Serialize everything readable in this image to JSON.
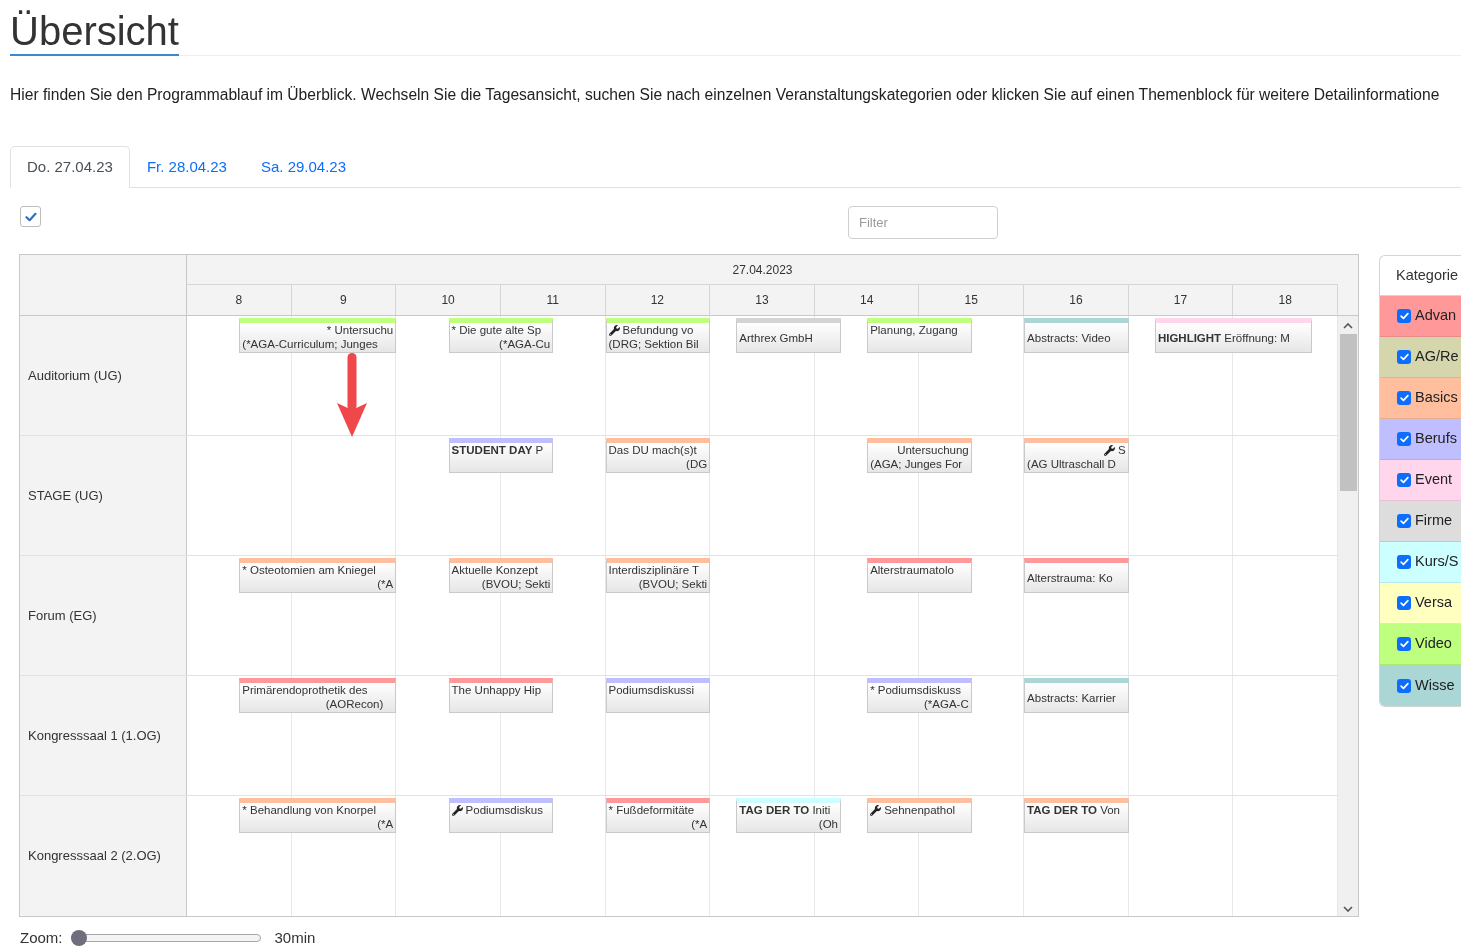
{
  "page": {
    "title": "Übersicht",
    "intro": "Hier finden Sie den Programmablauf im Überblick. Wechseln Sie die Tagesansicht, suchen Sie nach einzelnen Veranstaltungskategorien oder klicken Sie auf einen Themenblock für weitere Detailinformatione"
  },
  "tabs": [
    {
      "label": "Do. 27.04.23",
      "selected": true
    },
    {
      "label": "Fr. 28.04.23",
      "selected": false
    },
    {
      "label": "Sa. 29.04.23",
      "selected": false
    }
  ],
  "checkbox": {
    "checked": true
  },
  "filter": {
    "placeholder": "Filter"
  },
  "schedule": {
    "date": "27.04.2023",
    "hours": [
      "8",
      "9",
      "10",
      "11",
      "12",
      "13",
      "14",
      "15",
      "16",
      "17",
      "18"
    ],
    "rooms": [
      {
        "name": "Auditorium (UG)",
        "events": [
          {
            "kind": "plain",
            "color": "#bfff80",
            "lines": [
              "* Untersuchu",
              "(*AGA-Curriculum; Junges"
            ]
          },
          {
            "kind": "plain",
            "color": "#bfff80",
            "lines": [
              "* Die gute alte Sp",
              "(*AGA-Cu"
            ]
          },
          {
            "kind": "tool",
            "color": "#bfff80",
            "lines": [
              "Befundung vo",
              "(DRG; Sektion Bil"
            ]
          },
          {
            "kind": "plain",
            "color": "#d4d4d4",
            "lines": [
              "Arthrex GmbH"
            ]
          },
          {
            "kind": "plain",
            "color": "#bfff80",
            "lines": [
              "Planung, Zugang"
            ]
          },
          {
            "kind": "plain",
            "color": "#aad6d6",
            "lines": [
              "Abstracts: Video"
            ]
          },
          {
            "kind": "plain",
            "color": "#ffd6eb",
            "lines": [
              "**HIGHLIGHT** Eröffnung: M"
            ]
          }
        ]
      },
      {
        "name": "STAGE (UG)",
        "events": [
          {
            "kind": "plain",
            "color": "#bfbfff",
            "lines": [
              "**STUDENT DAY** P"
            ]
          },
          {
            "kind": "plain",
            "color": "#ffbf9f",
            "lines": [
              "Das DU mach(s)t",
              "(DG"
            ]
          },
          {
            "kind": "plain",
            "color": "#ffbf9f",
            "lines": [
              "Untersuchung",
              "(AGA; Junges For"
            ]
          },
          {
            "kind": "tool",
            "color": "#ffbf9f",
            "lines": [
              "S",
              "(AG Ultraschall D"
            ]
          }
        ]
      },
      {
        "name": "Forum (EG)",
        "events": [
          {
            "kind": "plain",
            "color": "#ffbf9f",
            "lines": [
              "* Osteotomien am Kniegel",
              "(*A"
            ]
          },
          {
            "kind": "plain",
            "color": "#ffbf9f",
            "lines": [
              "Aktuelle Konzept",
              "(BVOU; Sekti"
            ]
          },
          {
            "kind": "plain",
            "color": "#ffbf9f",
            "lines": [
              "Interdisziplinäre T",
              "(BVOU; Sekti"
            ]
          },
          {
            "kind": "plain",
            "color": "#ff9999",
            "lines": [
              "Alterstraumatolo"
            ]
          },
          {
            "kind": "plain",
            "color": "#ff9999",
            "lines": [
              "Alterstrauma: Ko"
            ]
          }
        ]
      },
      {
        "name": "Kongresssaal 1 (1.OG)",
        "events": [
          {
            "kind": "plain",
            "color": "#ff9999",
            "lines": [
              "Primärendoprothetik des",
              "(AORecon)"
            ]
          },
          {
            "kind": "plain",
            "color": "#ff9999",
            "lines": [
              "The Unhappy Hip"
            ]
          },
          {
            "kind": "plain",
            "color": "#bfbfff",
            "lines": [
              "Podiumsdiskussi"
            ]
          },
          {
            "kind": "plain",
            "color": "#bfbfff",
            "lines": [
              "* Podiumsdiskuss",
              "(*AGA-C"
            ]
          },
          {
            "kind": "plain",
            "color": "#aad6d6",
            "lines": [
              "Abstracts: Karrier"
            ]
          }
        ]
      },
      {
        "name": "Kongresssaal 2 (2.OG)",
        "events": [
          {
            "kind": "plain",
            "color": "#ffbf9f",
            "lines": [
              "* Behandlung von Knorpel",
              "(*A"
            ]
          },
          {
            "kind": "tool",
            "color": "#bfbfff",
            "lines": [
              "Podiumsdiskus"
            ]
          },
          {
            "kind": "plain",
            "color": "#ff9999",
            "lines": [
              "* Fußdeformitäte",
              "(*A"
            ]
          },
          {
            "kind": "plain",
            "color": "#ccffff",
            "lines": [
              "**TAG DER TO** Initi",
              "(Oh"
            ]
          },
          {
            "kind": "tool",
            "color": "#ffbf9f",
            "lines": [
              "Sehnenpathol"
            ]
          },
          {
            "kind": "plain",
            "color": "#ffbf9f",
            "lines": [
              "**TAG DER TO** Von"
            ]
          }
        ]
      }
    ]
  },
  "categories": {
    "title": "Kategorie",
    "items": [
      {
        "label": "Advan",
        "color": "#ff9999",
        "checked": true
      },
      {
        "label": "AG/Re",
        "color": "#d6d6ad",
        "checked": true
      },
      {
        "label": "Basics",
        "color": "#ffbf9f",
        "checked": true
      },
      {
        "label": "Berufs",
        "color": "#bfbfff",
        "checked": true
      },
      {
        "label": "Event",
        "color": "#ffd6eb",
        "checked": true
      },
      {
        "label": "Firme",
        "color": "#dddddd",
        "checked": true
      },
      {
        "label": "Kurs/S",
        "color": "#ccffff",
        "checked": true
      },
      {
        "label": "Versa",
        "color": "#ffffc0",
        "checked": true
      },
      {
        "label": "Video",
        "color": "#bfff80",
        "checked": true
      },
      {
        "label": "Wisse",
        "color": "#aad6d6",
        "checked": true
      }
    ]
  },
  "zoom": {
    "label": "Zoom:",
    "level": 0,
    "value": "30min"
  }
}
